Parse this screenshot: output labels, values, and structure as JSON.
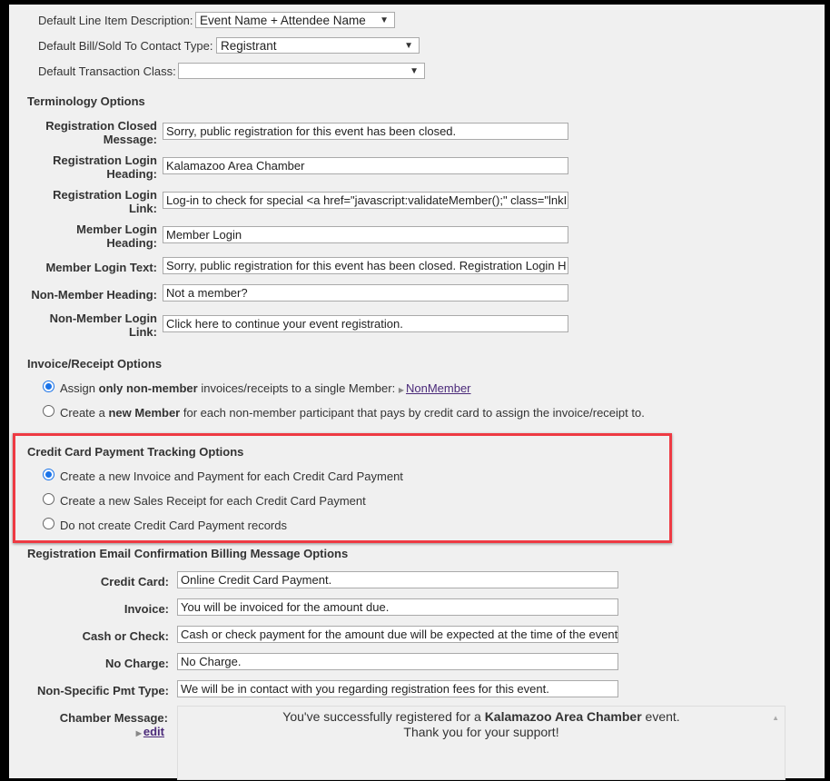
{
  "defaults": [
    {
      "label": "Default Line Item Description:",
      "value": "Event Name + Attendee Name"
    },
    {
      "label": "Default Bill/Sold To Contact Type:",
      "value": "Registrant"
    },
    {
      "label": "Default Transaction Class:",
      "value": ""
    }
  ],
  "terminology": {
    "heading": "Terminology Options",
    "rows": [
      {
        "label": "Registration Closed Message:",
        "value": "Sorry, public registration for this event has been closed."
      },
      {
        "label": "Registration Login Heading:",
        "value": "Kalamazoo Area Chamber"
      },
      {
        "label": "Registration Login Link:",
        "value": "Log-in to check for special <a href=\"javascript:validateMember();\" class=\"lnkI"
      },
      {
        "label": "Member Login Heading:",
        "value": "Member Login"
      },
      {
        "label": "Member Login Text:",
        "value": "Sorry, public registration for this event has been closed. Registration Login H"
      },
      {
        "label": "Non-Member Heading:",
        "value": "Not a member?"
      },
      {
        "label": "Non-Member Login Link:",
        "value": "Click here to continue your event registration."
      }
    ]
  },
  "invoice": {
    "heading": "Invoice/Receipt Options",
    "opt1": {
      "pre": "Assign ",
      "bold": "only non-member",
      "post": " invoices/receipts to a single Member: ",
      "link": "NonMember",
      "selected": true
    },
    "opt2": {
      "pre": "Create a ",
      "bold": "new Member",
      "post": " for each non-member participant that pays by credit card to assign the invoice/receipt to.",
      "selected": false
    }
  },
  "credit_card": {
    "heading": "Credit Card Payment Tracking Options",
    "options": [
      {
        "label": "Create a new Invoice and Payment for each Credit Card Payment",
        "selected": true
      },
      {
        "label": "Create a new Sales Receipt for each Credit Card Payment",
        "selected": false
      },
      {
        "label": "Do not create Credit Card Payment records",
        "selected": false
      }
    ]
  },
  "billing": {
    "heading": "Registration Email Confirmation Billing Message Options",
    "rows": [
      {
        "label": "Credit Card:",
        "value": "Online Credit Card Payment."
      },
      {
        "label": "Invoice:",
        "value": "You will be invoiced for the amount due."
      },
      {
        "label": "Cash or Check:",
        "value": "Cash or check payment for the amount due will be expected at the time of the event"
      },
      {
        "label": "No Charge:",
        "value": "No Charge."
      },
      {
        "label": "Non-Specific Pmt Type:",
        "value": "We will be in contact with you regarding registration fees for this event."
      }
    ]
  },
  "chamber": {
    "label": "Chamber Message:",
    "edit": "edit",
    "line1_pre": "You've successfully registered for a ",
    "line1_bold": "Kalamazoo Area Chamber",
    "line1_post": " event.",
    "line2": "Thank you for your support!"
  }
}
